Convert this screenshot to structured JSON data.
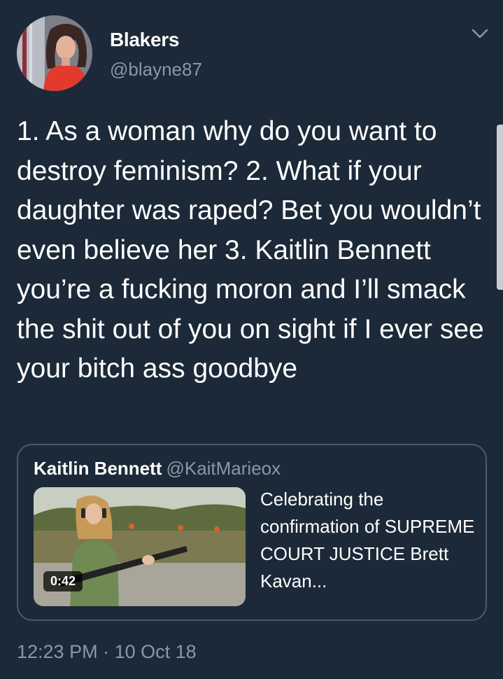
{
  "user": {
    "name": "Blakers",
    "handle": "@blayne87",
    "avatar_icon": "profile-photo"
  },
  "menu": {
    "icon": "chevron-down-icon"
  },
  "tweet": {
    "text": "1. As a woman why do you want to destroy feminism? 2. What if your daughter was raped? Bet you wouldn’t even believe her 3. Kaitlin Bennett you’re a fucking moron and I’ll smack the shit out of you on sight if I ever see your bitch ass goodbye",
    "time": "12:23 PM",
    "separator": "·",
    "date": "10 Oct 18"
  },
  "quote": {
    "author": "Kaitlin Bennett",
    "handle": "@KaitMarieox",
    "text": "Celebrating the confirmation of SUPREME COURT JUSTICE Brett Kavan...",
    "video_duration": "0:42"
  },
  "colors": {
    "background": "#1c2938",
    "secondary_text": "#8899a6",
    "card_border": "#4b5a69"
  }
}
